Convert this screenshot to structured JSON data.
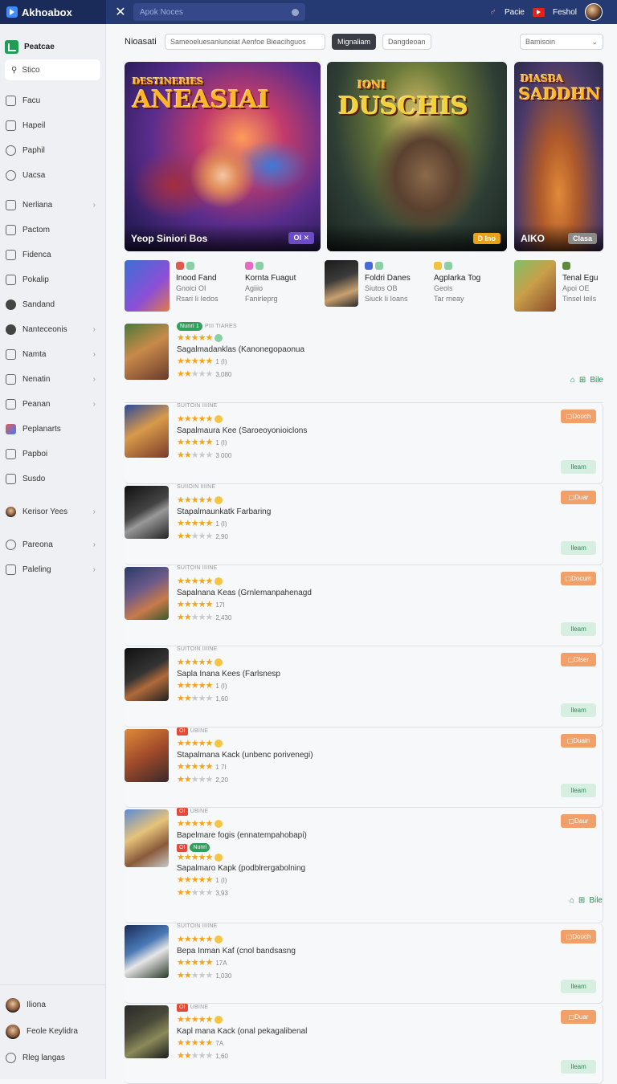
{
  "topbar": {
    "app_title": "Akhoabox",
    "close_label": "✕",
    "search_placeholder": "Apok Noces",
    "right_item1": "Pacie",
    "right_item2": "Feshol"
  },
  "sidebar": {
    "brand": "Peatcae",
    "search_placeholder": "Stico",
    "items": [
      {
        "label": "Facu",
        "icon": "page-icon",
        "chevron": false
      },
      {
        "label": "Hapeil",
        "icon": "bag-icon",
        "chevron": false
      },
      {
        "label": "Paphil",
        "icon": "clock-icon",
        "chevron": false
      },
      {
        "label": "Uacsa",
        "icon": "circle-icon",
        "chevron": false
      },
      {
        "label": "Nerliana",
        "icon": "folder-icon",
        "chevron": true
      },
      {
        "label": "Pactom",
        "icon": "tag-icon",
        "chevron": false
      },
      {
        "label": "Fidenca",
        "icon": "pencil-icon",
        "chevron": false
      },
      {
        "label": "Pokalip",
        "icon": "pen-icon",
        "chevron": false
      },
      {
        "label": "Sandand",
        "icon": "gear-icon",
        "chevron": false
      },
      {
        "label": "Nanteceonis",
        "icon": "user-icon",
        "chevron": true
      },
      {
        "label": "Namta",
        "icon": "box-icon",
        "chevron": true
      },
      {
        "label": "Nenatin",
        "icon": "image-icon",
        "chevron": true
      },
      {
        "label": "Peanan",
        "icon": "list-icon",
        "chevron": true
      },
      {
        "label": "Peplanarts",
        "icon": "game-icon",
        "chevron": false
      },
      {
        "label": "Papboi",
        "icon": "doc-icon",
        "chevron": false
      },
      {
        "label": "Susdo",
        "icon": "check-icon",
        "chevron": false
      },
      {
        "label": "Kerisor Yees",
        "icon": "avatar-icon",
        "chevron": true
      },
      {
        "label": "Pareona",
        "icon": "clock-icon",
        "chevron": true
      },
      {
        "label": "Paleling",
        "icon": "folder-icon",
        "chevron": true
      }
    ],
    "bottom": [
      {
        "label": "Iliona",
        "icon": "avatar-icon"
      },
      {
        "label": "Feole Keylidra",
        "icon": "avatar-icon"
      },
      {
        "label": "Rleg langas",
        "icon": "chevron-circle-icon"
      }
    ]
  },
  "filter": {
    "label": "Nioasati",
    "search_text": "Sameoeluesanlunoiat Aenfoe Bieacihguos",
    "active_pill": "Mignaliam",
    "pill2": "Dangdeoan",
    "select_value": "Bamisoin"
  },
  "banners": [
    {
      "title_art": "ANEASIAI",
      "sub_art": "DESTINERIES",
      "caption": "Yeop Siniori Bos",
      "tag": "OI ✕"
    },
    {
      "title_art": "DUSCHIS",
      "sub_art": "IONI",
      "caption": "",
      "tag": "D Ino"
    },
    {
      "title_art": "SADDHN",
      "sub_art": "DIASBA",
      "caption": "AIKO",
      "tag": "Clasa"
    }
  ],
  "featured": [
    {
      "title": "Inood Fand",
      "sub1": "Gnoici OI",
      "sub2": "Rsari Ii Iedos"
    },
    {
      "title": "Kornta Fuagut",
      "sub1": "Agiiio",
      "sub2": "Fanirleprg"
    },
    {
      "title": "Foldri Danes",
      "sub1": "Siutos OB",
      "sub2": "Siuck Ii Ioans"
    },
    {
      "title": "Agplarka Tog",
      "sub1": "Geols",
      "sub2": "Tar rneay"
    },
    {
      "title": "Tenal Egu",
      "sub1": "Apoi OE",
      "sub2": "Tinsel Ieils"
    }
  ],
  "list": [
    {
      "top": "PIII TIARES",
      "tag": "Nunri 1",
      "title": "Sagalmadanklas (Kanonegopaonua",
      "rating_text": "1 (I)",
      "count": "3,080",
      "badge_o": "",
      "badge_g": "",
      "extra": "Bile"
    },
    {
      "top": "SUITOIN IIIINE",
      "tag": "",
      "title": "Sapalmaura Kee (Saroeoyonioiclons",
      "rating_text": "1 (I)",
      "count": "3 000",
      "badge_o": "Dooch",
      "badge_g": "Ileam",
      "extra": ""
    },
    {
      "top": "SUIIOIN IIIINE",
      "tag": "",
      "title": "Stapalmaunkatk Farbaring",
      "rating_text": "1 (I)",
      "count": "2,90",
      "badge_o": "Duar",
      "badge_g": "Ileam",
      "extra": ""
    },
    {
      "top": "SUITOIN IIIINE",
      "tag": "",
      "title": "Sapalnana Keas (Grnlemanpahenagd",
      "rating_text": "17I",
      "count": "2,430",
      "badge_o": "Docum",
      "badge_g": "Ileam",
      "extra": ""
    },
    {
      "top": "SUITOIN IIIINE",
      "tag": "",
      "title": "Sapla Inana Kees (Farlsnesp",
      "rating_text": "1 (I)",
      "count": "1,60",
      "badge_o": "Dlser",
      "badge_g": "Ileam",
      "extra": ""
    },
    {
      "top": "UBINE",
      "tag": "OI",
      "title": "Stapalmana Kack (unbenc porivenegi)",
      "rating_text": "1 7I",
      "count": "2,20",
      "badge_o": "Duain",
      "badge_g": "Ileam",
      "extra": ""
    },
    {
      "top": "UBINE",
      "tag": "OI",
      "title": "Bapelmare fogis (ennatempahobapi)",
      "title2": "Sapalmaro Kapk (podblrergabolning",
      "rating_text": "1 (I)",
      "count": "3,93",
      "badge_o": "Daur",
      "badge_g": "",
      "extra": "Bile"
    },
    {
      "top": "SUITOIN IIIINE",
      "tag": "",
      "title": "Bepa Inman Kaf (cnol bandsasng",
      "rating_text": "17A",
      "count": "1,030",
      "badge_o": "Dooch",
      "badge_g": "Ileam",
      "extra": ""
    },
    {
      "top": "UBINE",
      "tag": "OI",
      "title": "Kapl mana Kack (onal pekagalibenal",
      "rating_text": "7A",
      "count": "1,60",
      "badge_o": "Duar",
      "badge_g": "Ileam",
      "extra": ""
    }
  ],
  "colors": {
    "topbar": "#253a72",
    "accent_orange": "#f1a06a",
    "accent_green": "#2ea25c",
    "star": "#f6a317"
  }
}
